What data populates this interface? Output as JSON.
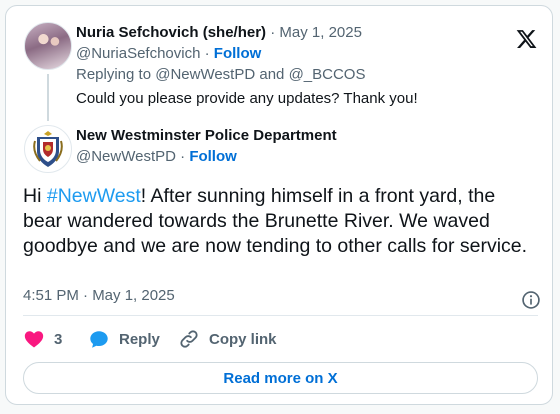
{
  "reply": {
    "author_name": "Nuria Sefchovich (she/her)",
    "date_sep": "·",
    "date": "May 1, 2025",
    "handle": "@NuriaSefchovich",
    "handle_sep": "·",
    "follow": "Follow",
    "replying_prefix": "Replying to",
    "replying_to_1": "@NewWestPD",
    "replying_and": "and",
    "replying_to_2": "@_BCCOS",
    "text": "Could you please provide any updates? Thank you!"
  },
  "tweet": {
    "author_name": "New Westminster Police Department",
    "handle": "@NewWestPD",
    "handle_sep": "·",
    "follow": "Follow",
    "text_before": "Hi ",
    "hashtag": "#NewWest",
    "text_after": "! After sunning himself in a front yard, the bear wandered towards the Brunette River. We waved goodbye and we are now tending to other calls for service.",
    "timestamp": "4:51 PM · May 1, 2025"
  },
  "actions": {
    "like_count": "3",
    "reply_label": "Reply",
    "copy_label": "Copy link"
  },
  "read_more": "Read more on X",
  "icons": {
    "logo": "x-logo-icon",
    "info": "info-icon",
    "like": "heart-icon",
    "reply": "reply-bubble-icon",
    "copy": "link-icon"
  },
  "colors": {
    "link": "#1d9bf0",
    "follow": "#006fd6",
    "muted": "#536471",
    "heart": "#f91880",
    "reply_icon": "#1d9bf0",
    "border": "#cfd9de"
  }
}
